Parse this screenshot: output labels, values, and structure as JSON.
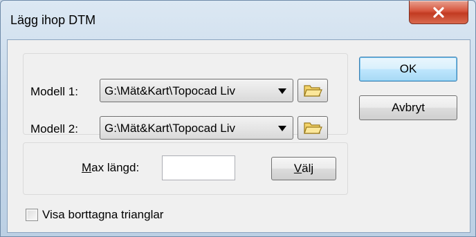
{
  "window": {
    "title": "Lägg ihop DTM",
    "close_label": "X"
  },
  "models": {
    "model1_label": "Modell 1:",
    "model1_value": "G:\\Mät&Kart\\Topocad Liv",
    "model2_label": "Modell 2:",
    "model2_value": "G:\\Mät&Kart\\Topocad Liv"
  },
  "buttons": {
    "ok_label": "OK",
    "cancel_label": "Avbryt"
  },
  "max_length": {
    "label_mnemonic": "M",
    "label_rest": "ax längd:",
    "value": "",
    "select_mnemonic": "V",
    "select_rest": "älj"
  },
  "options": {
    "show_removed_label": "Visa borttagna trianglar",
    "show_removed_checked": false
  },
  "icons": {
    "folder": "folder-icon",
    "dropdown": "dropdown-arrow-icon",
    "close": "close-icon"
  }
}
